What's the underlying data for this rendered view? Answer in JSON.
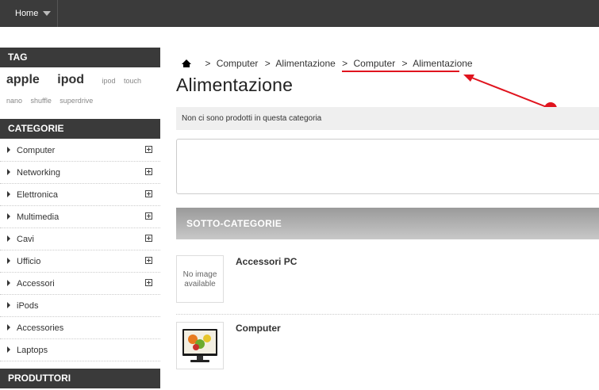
{
  "topnav": {
    "home_label": "Home"
  },
  "sidebar": {
    "tag_title": "TAG",
    "tags_line1": [
      {
        "label": "apple",
        "size": "big"
      },
      {
        "label": "ipod",
        "size": "big"
      },
      {
        "label": "ipod",
        "size": "small"
      },
      {
        "label": "touch",
        "size": "small"
      }
    ],
    "tags_line2": [
      "nano",
      "shuffle",
      "superdrive"
    ],
    "categories_title": "CATEGORIE",
    "categories": [
      {
        "label": "Computer",
        "expandable": true
      },
      {
        "label": "Networking",
        "expandable": true
      },
      {
        "label": "Elettronica",
        "expandable": true
      },
      {
        "label": "Multimedia",
        "expandable": true
      },
      {
        "label": "Cavi",
        "expandable": true
      },
      {
        "label": "Ufficio",
        "expandable": true
      },
      {
        "label": "Accessori",
        "expandable": true
      },
      {
        "label": "iPods",
        "expandable": false
      },
      {
        "label": "Accessories",
        "expandable": false
      },
      {
        "label": "Laptops",
        "expandable": false
      }
    ],
    "manufacturers_title": "PRODUTTORI"
  },
  "breadcrumb": {
    "separator": ">",
    "items": [
      "Computer",
      "Alimentazione",
      "Computer",
      "Alimentazione"
    ]
  },
  "main": {
    "title": "Alimentazione",
    "empty_message": "Non ci sono prodotti in questa categoria",
    "subcategories_title": "SOTTO-CATEGORIE",
    "subcategories": [
      {
        "name": "Accessori PC",
        "image_text": "No image available"
      },
      {
        "name": "Computer",
        "image_text": ""
      }
    ]
  },
  "colors": {
    "annotation_red": "#e0141e",
    "topbar": "#3b3b3b",
    "block_title": "#3a3a3a"
  }
}
